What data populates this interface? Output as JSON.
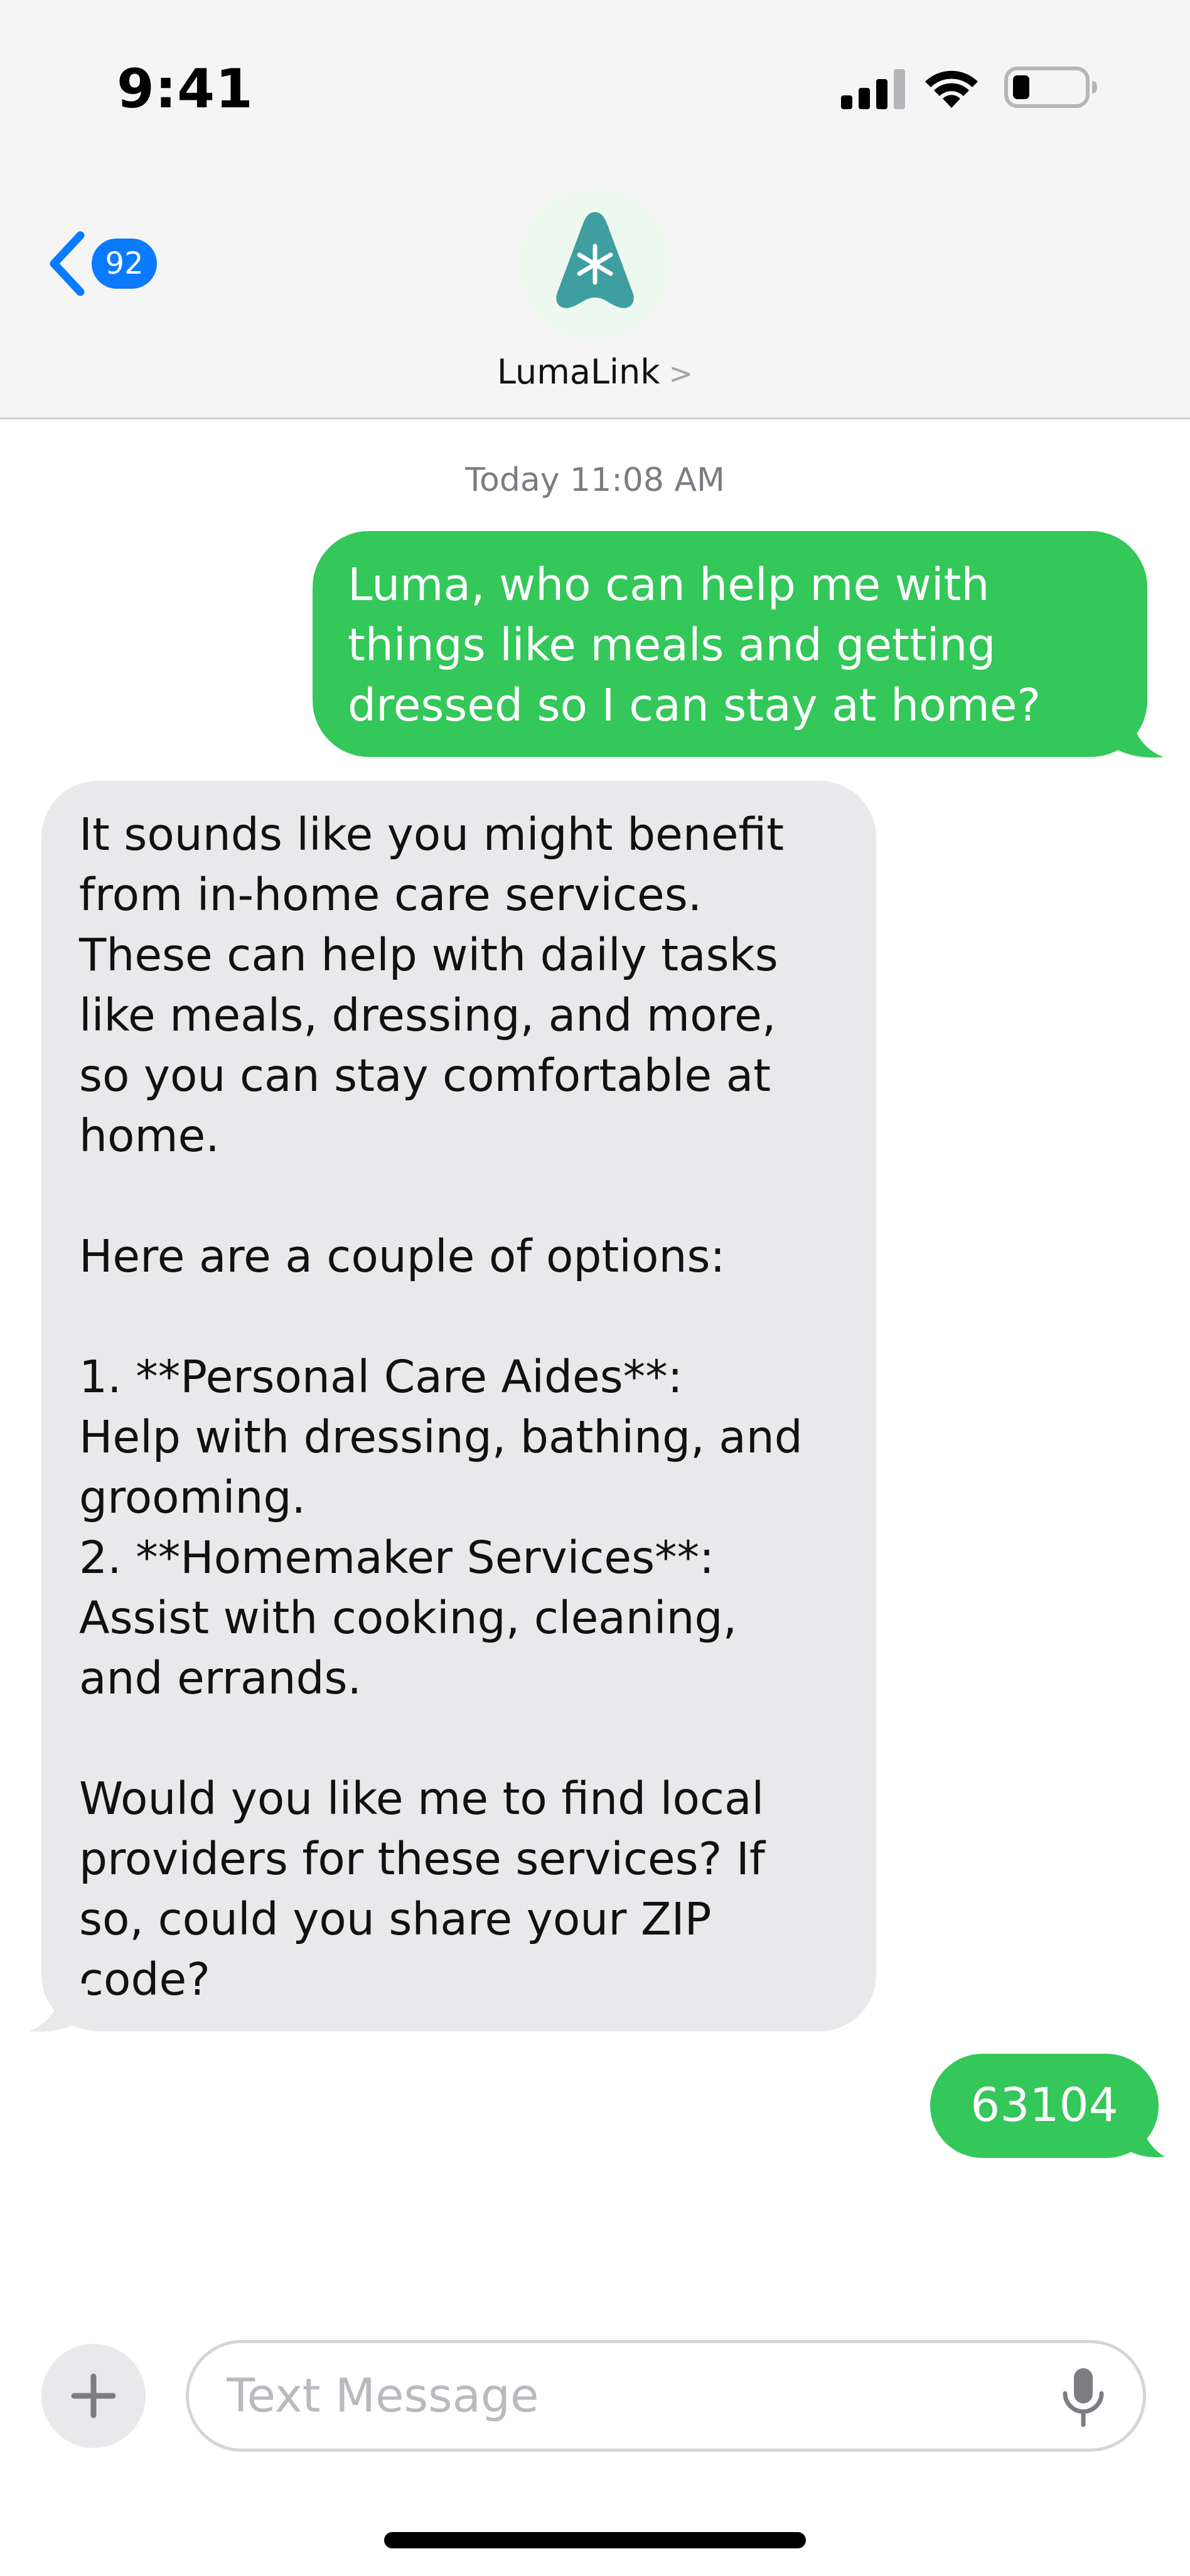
{
  "status_bar": {
    "time": "9:41"
  },
  "nav": {
    "unread_count": "92",
    "contact_name": "LumaLink",
    "contact_chevron": ">",
    "avatar_icon": "luma-logo-icon"
  },
  "conversation": {
    "timestamp": "Today 11:08 AM",
    "messages": [
      {
        "direction": "outgoing",
        "text": "Luma, who can help me with\nthings like meals and getting\ndressed so I can stay at home?"
      },
      {
        "direction": "incoming",
        "text": "It sounds like you might benefit\nfrom in-home care services.\nThese can help with daily tasks\nlike meals, dressing, and more,\nso you can stay comfortable at\nhome.\n\nHere are a couple of options:\n\n1. **Personal Care Aides**:\nHelp with dressing, bathing, and\ngrooming.\n2. **Homemaker Services**:\nAssist with cooking, cleaning,\nand errands.\n\nWould you like me to find local\nproviders for these services? If\nso, could you share your ZIP\ncode?"
      },
      {
        "direction": "outgoing",
        "text": "63104"
      }
    ]
  },
  "composer": {
    "placeholder": "Text Message",
    "value": ""
  },
  "colors": {
    "outgoing_bubble": "#34c759",
    "incoming_bubble": "#e9e9eb",
    "accent": "#0a7aff",
    "avatar_teal": "#3f9fa0"
  }
}
